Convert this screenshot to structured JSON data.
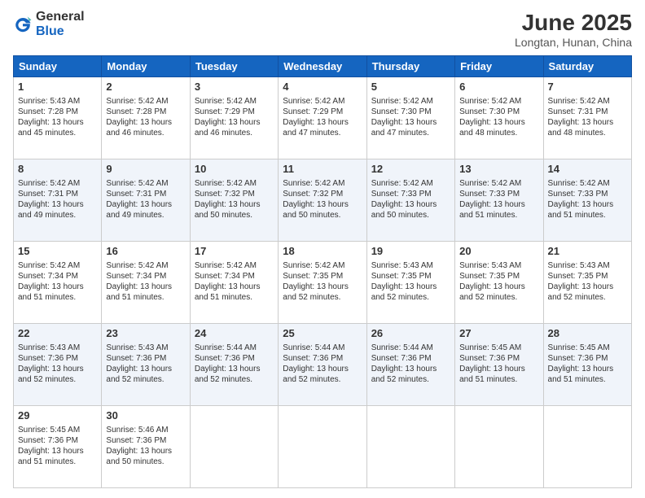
{
  "header": {
    "logo_general": "General",
    "logo_blue": "Blue",
    "title": "June 2025",
    "location": "Longtan, Hunan, China"
  },
  "days_of_week": [
    "Sunday",
    "Monday",
    "Tuesday",
    "Wednesday",
    "Thursday",
    "Friday",
    "Saturday"
  ],
  "weeks": [
    {
      "shaded": false,
      "days": [
        {
          "num": "1",
          "sunrise": "Sunrise: 5:43 AM",
          "sunset": "Sunset: 7:28 PM",
          "daylight": "Daylight: 13 hours and 45 minutes."
        },
        {
          "num": "2",
          "sunrise": "Sunrise: 5:42 AM",
          "sunset": "Sunset: 7:28 PM",
          "daylight": "Daylight: 13 hours and 46 minutes."
        },
        {
          "num": "3",
          "sunrise": "Sunrise: 5:42 AM",
          "sunset": "Sunset: 7:29 PM",
          "daylight": "Daylight: 13 hours and 46 minutes."
        },
        {
          "num": "4",
          "sunrise": "Sunrise: 5:42 AM",
          "sunset": "Sunset: 7:29 PM",
          "daylight": "Daylight: 13 hours and 47 minutes."
        },
        {
          "num": "5",
          "sunrise": "Sunrise: 5:42 AM",
          "sunset": "Sunset: 7:30 PM",
          "daylight": "Daylight: 13 hours and 47 minutes."
        },
        {
          "num": "6",
          "sunrise": "Sunrise: 5:42 AM",
          "sunset": "Sunset: 7:30 PM",
          "daylight": "Daylight: 13 hours and 48 minutes."
        },
        {
          "num": "7",
          "sunrise": "Sunrise: 5:42 AM",
          "sunset": "Sunset: 7:31 PM",
          "daylight": "Daylight: 13 hours and 48 minutes."
        }
      ]
    },
    {
      "shaded": true,
      "days": [
        {
          "num": "8",
          "sunrise": "Sunrise: 5:42 AM",
          "sunset": "Sunset: 7:31 PM",
          "daylight": "Daylight: 13 hours and 49 minutes."
        },
        {
          "num": "9",
          "sunrise": "Sunrise: 5:42 AM",
          "sunset": "Sunset: 7:31 PM",
          "daylight": "Daylight: 13 hours and 49 minutes."
        },
        {
          "num": "10",
          "sunrise": "Sunrise: 5:42 AM",
          "sunset": "Sunset: 7:32 PM",
          "daylight": "Daylight: 13 hours and 50 minutes."
        },
        {
          "num": "11",
          "sunrise": "Sunrise: 5:42 AM",
          "sunset": "Sunset: 7:32 PM",
          "daylight": "Daylight: 13 hours and 50 minutes."
        },
        {
          "num": "12",
          "sunrise": "Sunrise: 5:42 AM",
          "sunset": "Sunset: 7:33 PM",
          "daylight": "Daylight: 13 hours and 50 minutes."
        },
        {
          "num": "13",
          "sunrise": "Sunrise: 5:42 AM",
          "sunset": "Sunset: 7:33 PM",
          "daylight": "Daylight: 13 hours and 51 minutes."
        },
        {
          "num": "14",
          "sunrise": "Sunrise: 5:42 AM",
          "sunset": "Sunset: 7:33 PM",
          "daylight": "Daylight: 13 hours and 51 minutes."
        }
      ]
    },
    {
      "shaded": false,
      "days": [
        {
          "num": "15",
          "sunrise": "Sunrise: 5:42 AM",
          "sunset": "Sunset: 7:34 PM",
          "daylight": "Daylight: 13 hours and 51 minutes."
        },
        {
          "num": "16",
          "sunrise": "Sunrise: 5:42 AM",
          "sunset": "Sunset: 7:34 PM",
          "daylight": "Daylight: 13 hours and 51 minutes."
        },
        {
          "num": "17",
          "sunrise": "Sunrise: 5:42 AM",
          "sunset": "Sunset: 7:34 PM",
          "daylight": "Daylight: 13 hours and 51 minutes."
        },
        {
          "num": "18",
          "sunrise": "Sunrise: 5:42 AM",
          "sunset": "Sunset: 7:35 PM",
          "daylight": "Daylight: 13 hours and 52 minutes."
        },
        {
          "num": "19",
          "sunrise": "Sunrise: 5:43 AM",
          "sunset": "Sunset: 7:35 PM",
          "daylight": "Daylight: 13 hours and 52 minutes."
        },
        {
          "num": "20",
          "sunrise": "Sunrise: 5:43 AM",
          "sunset": "Sunset: 7:35 PM",
          "daylight": "Daylight: 13 hours and 52 minutes."
        },
        {
          "num": "21",
          "sunrise": "Sunrise: 5:43 AM",
          "sunset": "Sunset: 7:35 PM",
          "daylight": "Daylight: 13 hours and 52 minutes."
        }
      ]
    },
    {
      "shaded": true,
      "days": [
        {
          "num": "22",
          "sunrise": "Sunrise: 5:43 AM",
          "sunset": "Sunset: 7:36 PM",
          "daylight": "Daylight: 13 hours and 52 minutes."
        },
        {
          "num": "23",
          "sunrise": "Sunrise: 5:43 AM",
          "sunset": "Sunset: 7:36 PM",
          "daylight": "Daylight: 13 hours and 52 minutes."
        },
        {
          "num": "24",
          "sunrise": "Sunrise: 5:44 AM",
          "sunset": "Sunset: 7:36 PM",
          "daylight": "Daylight: 13 hours and 52 minutes."
        },
        {
          "num": "25",
          "sunrise": "Sunrise: 5:44 AM",
          "sunset": "Sunset: 7:36 PM",
          "daylight": "Daylight: 13 hours and 52 minutes."
        },
        {
          "num": "26",
          "sunrise": "Sunrise: 5:44 AM",
          "sunset": "Sunset: 7:36 PM",
          "daylight": "Daylight: 13 hours and 52 minutes."
        },
        {
          "num": "27",
          "sunrise": "Sunrise: 5:45 AM",
          "sunset": "Sunset: 7:36 PM",
          "daylight": "Daylight: 13 hours and 51 minutes."
        },
        {
          "num": "28",
          "sunrise": "Sunrise: 5:45 AM",
          "sunset": "Sunset: 7:36 PM",
          "daylight": "Daylight: 13 hours and 51 minutes."
        }
      ]
    },
    {
      "shaded": false,
      "days": [
        {
          "num": "29",
          "sunrise": "Sunrise: 5:45 AM",
          "sunset": "Sunset: 7:36 PM",
          "daylight": "Daylight: 13 hours and 51 minutes."
        },
        {
          "num": "30",
          "sunrise": "Sunrise: 5:46 AM",
          "sunset": "Sunset: 7:36 PM",
          "daylight": "Daylight: 13 hours and 50 minutes."
        },
        {
          "num": "",
          "sunrise": "",
          "sunset": "",
          "daylight": ""
        },
        {
          "num": "",
          "sunrise": "",
          "sunset": "",
          "daylight": ""
        },
        {
          "num": "",
          "sunrise": "",
          "sunset": "",
          "daylight": ""
        },
        {
          "num": "",
          "sunrise": "",
          "sunset": "",
          "daylight": ""
        },
        {
          "num": "",
          "sunrise": "",
          "sunset": "",
          "daylight": ""
        }
      ]
    }
  ]
}
